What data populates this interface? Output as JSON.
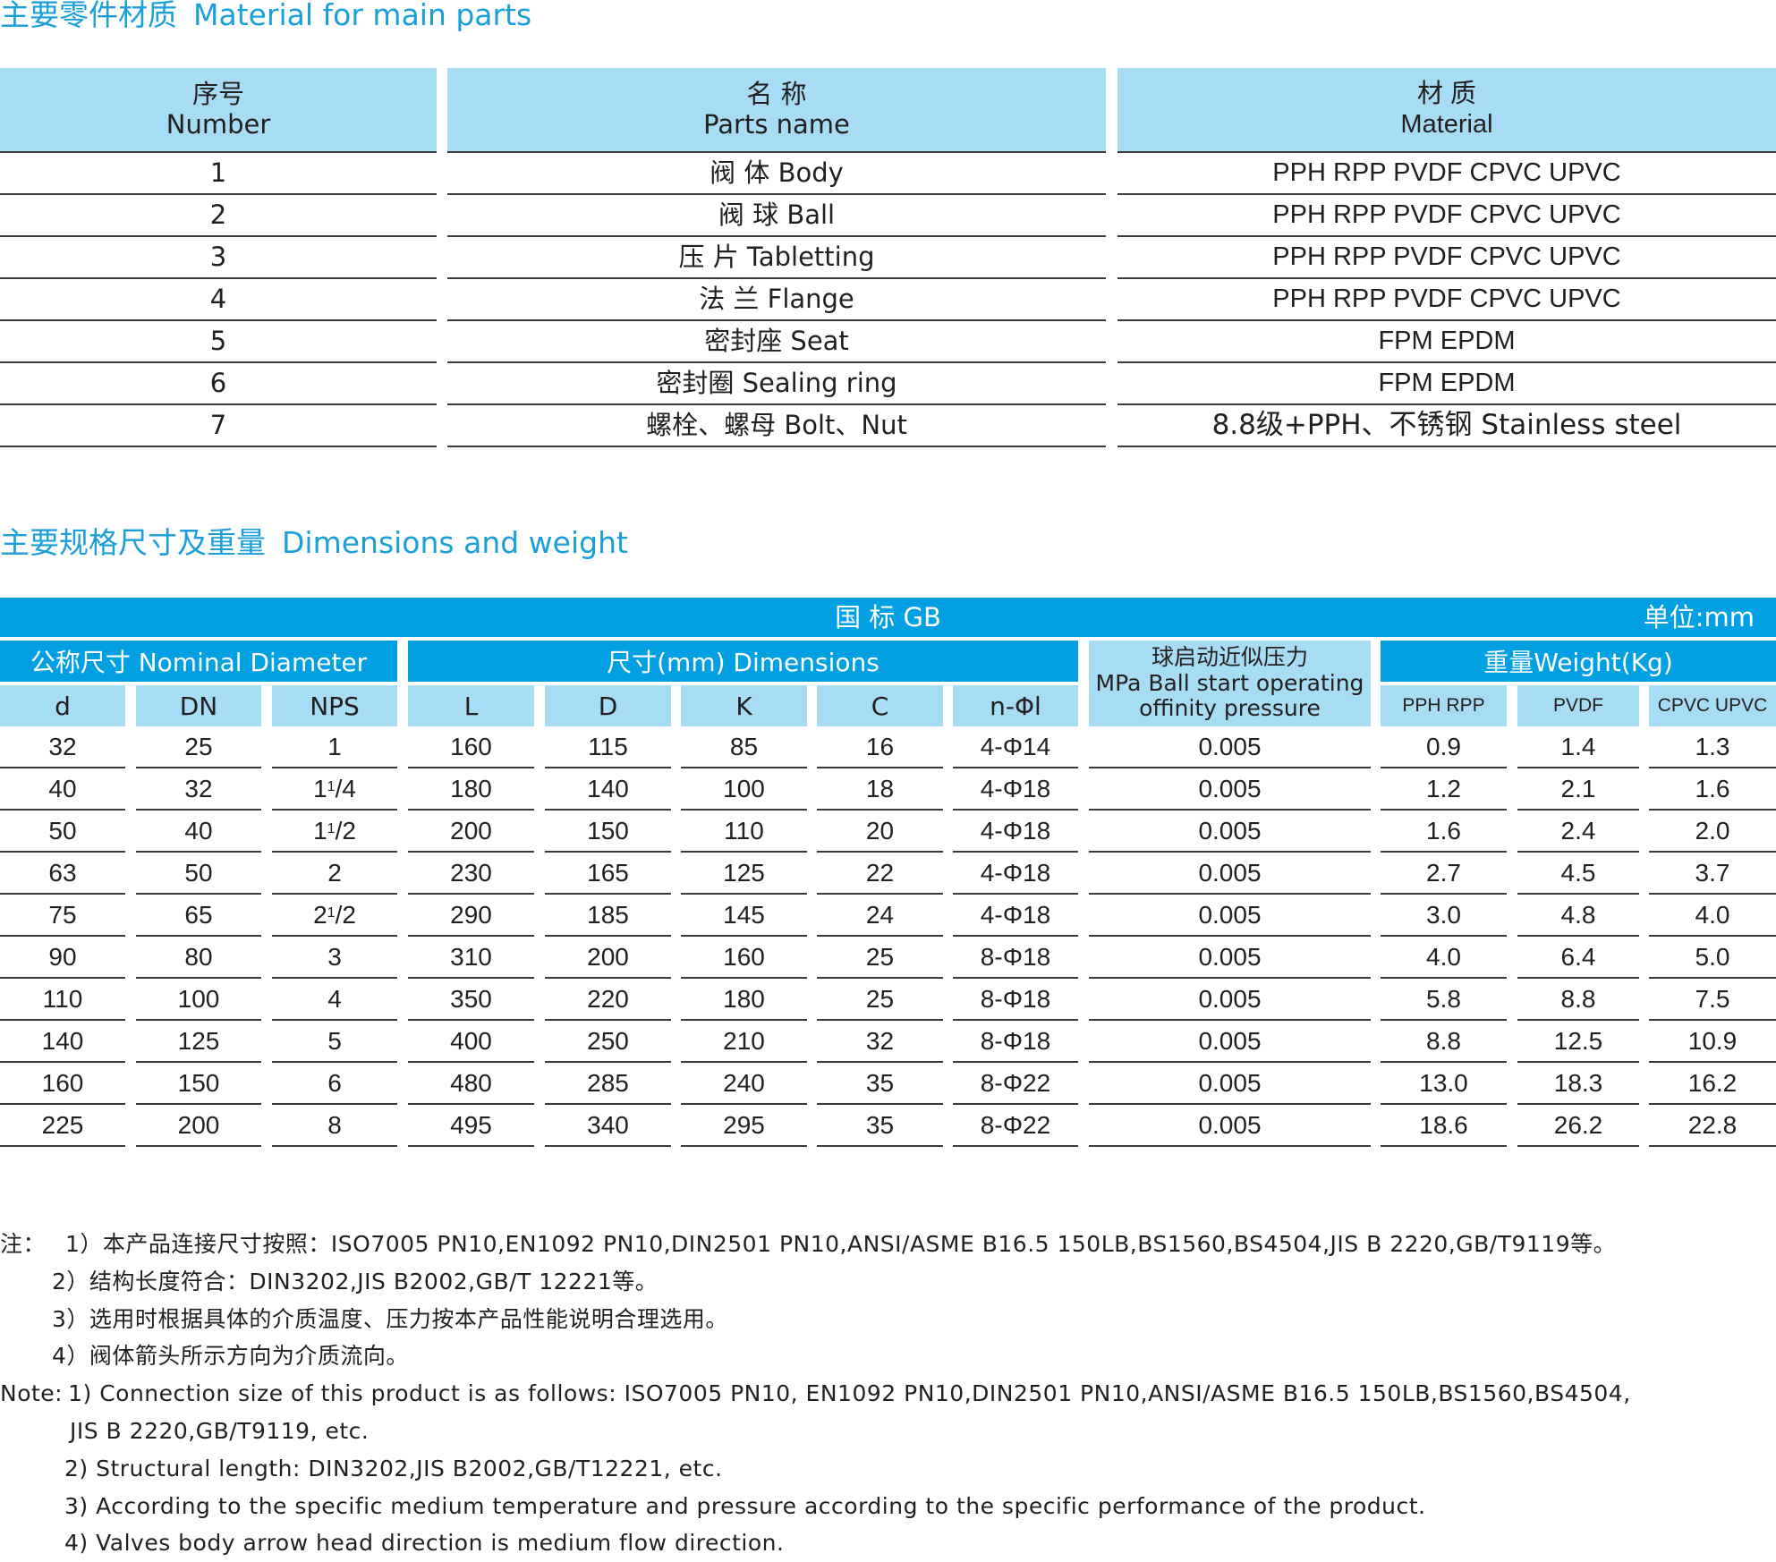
{
  "materials": {
    "title_cn": "主要零件材质",
    "title_en": "Material for main parts",
    "headers": [
      {
        "cn": "序号",
        "en": "Number"
      },
      {
        "cn": "名 称",
        "en": "Parts name"
      },
      {
        "cn": "材 质",
        "en": "Material"
      }
    ],
    "rows": [
      {
        "no": "1",
        "name": "阀 体  Body",
        "material": "PPH  RPP  PVDF  CPVC  UPVC"
      },
      {
        "no": "2",
        "name": "阀 球  Ball",
        "material": "PPH  RPP  PVDF  CPVC  UPVC"
      },
      {
        "no": "3",
        "name": "压 片  Tabletting",
        "material": "PPH  RPP  PVDF  CPVC  UPVC"
      },
      {
        "no": "4",
        "name": "法 兰  Flange",
        "material": "PPH  RPP  PVDF  CPVC  UPVC"
      },
      {
        "no": "5",
        "name": "密封座  Seat",
        "material": "FPM  EPDM"
      },
      {
        "no": "6",
        "name": "密封圈  Sealing ring",
        "material": "FPM  EPDM"
      },
      {
        "no": "7",
        "name": "螺栓、螺母  Bolt、Nut",
        "material": "8.8级+PPH、不锈钢 Stainless steel"
      }
    ]
  },
  "dimensions": {
    "title_cn": "主要规格尺寸及重量",
    "title_en": "Dimensions and weight",
    "standard": "国 标  GB",
    "unit": "单位:mm",
    "group_nominal": "公称尺寸  Nominal  Diameter",
    "group_dims": "尺寸(mm)   Dimensions",
    "pressure_lines": [
      "球启动近似压力",
      "MPa Ball start operating",
      "offinity pressure"
    ],
    "group_weight": "重量Weight(Kg)",
    "columns": [
      "d",
      "DN",
      "NPS",
      "L",
      "D",
      "K",
      "C",
      "n-Φl",
      "PPH RPP",
      "PVDF",
      "CPVC UPVC"
    ],
    "rows": [
      {
        "d": "32",
        "dn": "25",
        "nps_whole": "1",
        "nps_sup": "",
        "nps_den": "",
        "L": "160",
        "D": "115",
        "K": "85",
        "C": "16",
        "holes": "4-Φ14",
        "pressure": "0.005",
        "w_pph": "0.9",
        "w_pvdf": "1.4",
        "w_cpvc": "1.3"
      },
      {
        "d": "40",
        "dn": "32",
        "nps_whole": "1",
        "nps_sup": "1",
        "nps_den": "/4",
        "L": "180",
        "D": "140",
        "K": "100",
        "C": "18",
        "holes": "4-Φ18",
        "pressure": "0.005",
        "w_pph": "1.2",
        "w_pvdf": "2.1",
        "w_cpvc": "1.6"
      },
      {
        "d": "50",
        "dn": "40",
        "nps_whole": "1",
        "nps_sup": "1",
        "nps_den": "/2",
        "L": "200",
        "D": "150",
        "K": "110",
        "C": "20",
        "holes": "4-Φ18",
        "pressure": "0.005",
        "w_pph": "1.6",
        "w_pvdf": "2.4",
        "w_cpvc": "2.0"
      },
      {
        "d": "63",
        "dn": "50",
        "nps_whole": "2",
        "nps_sup": "",
        "nps_den": "",
        "L": "230",
        "D": "165",
        "K": "125",
        "C": "22",
        "holes": "4-Φ18",
        "pressure": "0.005",
        "w_pph": "2.7",
        "w_pvdf": "4.5",
        "w_cpvc": "3.7"
      },
      {
        "d": "75",
        "dn": "65",
        "nps_whole": "2",
        "nps_sup": "1",
        "nps_den": "/2",
        "L": "290",
        "D": "185",
        "K": "145",
        "C": "24",
        "holes": "4-Φ18",
        "pressure": "0.005",
        "w_pph": "3.0",
        "w_pvdf": "4.8",
        "w_cpvc": "4.0"
      },
      {
        "d": "90",
        "dn": "80",
        "nps_whole": "3",
        "nps_sup": "",
        "nps_den": "",
        "L": "310",
        "D": "200",
        "K": "160",
        "C": "25",
        "holes": "8-Φ18",
        "pressure": "0.005",
        "w_pph": "4.0",
        "w_pvdf": "6.4",
        "w_cpvc": "5.0"
      },
      {
        "d": "110",
        "dn": "100",
        "nps_whole": "4",
        "nps_sup": "",
        "nps_den": "",
        "L": "350",
        "D": "220",
        "K": "180",
        "C": "25",
        "holes": "8-Φ18",
        "pressure": "0.005",
        "w_pph": "5.8",
        "w_pvdf": "8.8",
        "w_cpvc": "7.5"
      },
      {
        "d": "140",
        "dn": "125",
        "nps_whole": "5",
        "nps_sup": "",
        "nps_den": "",
        "L": "400",
        "D": "250",
        "K": "210",
        "C": "32",
        "holes": "8-Φ18",
        "pressure": "0.005",
        "w_pph": "8.8",
        "w_pvdf": "12.5",
        "w_cpvc": "10.9"
      },
      {
        "d": "160",
        "dn": "150",
        "nps_whole": "6",
        "nps_sup": "",
        "nps_den": "",
        "L": "480",
        "D": "285",
        "K": "240",
        "C": "35",
        "holes": "8-Φ22",
        "pressure": "0.005",
        "w_pph": "13.0",
        "w_pvdf": "18.3",
        "w_cpvc": "16.2"
      },
      {
        "d": "225",
        "dn": "200",
        "nps_whole": "8",
        "nps_sup": "",
        "nps_den": "",
        "L": "495",
        "D": "340",
        "K": "295",
        "C": "35",
        "holes": "8-Φ22",
        "pressure": "0.005",
        "w_pph": "18.6",
        "w_pvdf": "26.2",
        "w_cpvc": "22.8"
      }
    ]
  },
  "notes": {
    "cn_prefix": "注：",
    "cn": [
      "1）本产品连接尺寸按照：ISO7005 PN10,EN1092 PN10,DIN2501 PN10,ANSI/ASME B16.5 150LB,BS1560,BS4504,JIS B 2220,GB/T9119等。",
      "2）结构长度符合：DIN3202,JIS B2002,GB/T 12221等。",
      "3）选用时根据具体的介质温度、压力按本产品性能说明合理选用。",
      "4）阀体箭头所示方向为介质流向。"
    ],
    "en_prefix": "Note:",
    "en_1a": "1) Connection size of this product is as follows: ISO7005 PN10, EN1092 PN10,DIN2501 PN10,ANSI/ASME B16.5 150LB,BS1560,BS4504,",
    "en_1b": "JIS B 2220,GB/T9119, etc.",
    "en_rest": [
      "2) Structural length: DIN3202,JIS B2002,GB/T12221, etc.",
      "3) According to the specific medium temperature and pressure according to the specific performance of the product.",
      "4) Valves body arrow head direction is medium flow direction."
    ]
  },
  "colors": {
    "title": "#1a9fd8",
    "band": "#00a0e3",
    "header_fill": "#a6dcf4",
    "rule": "#3a3a3a"
  }
}
